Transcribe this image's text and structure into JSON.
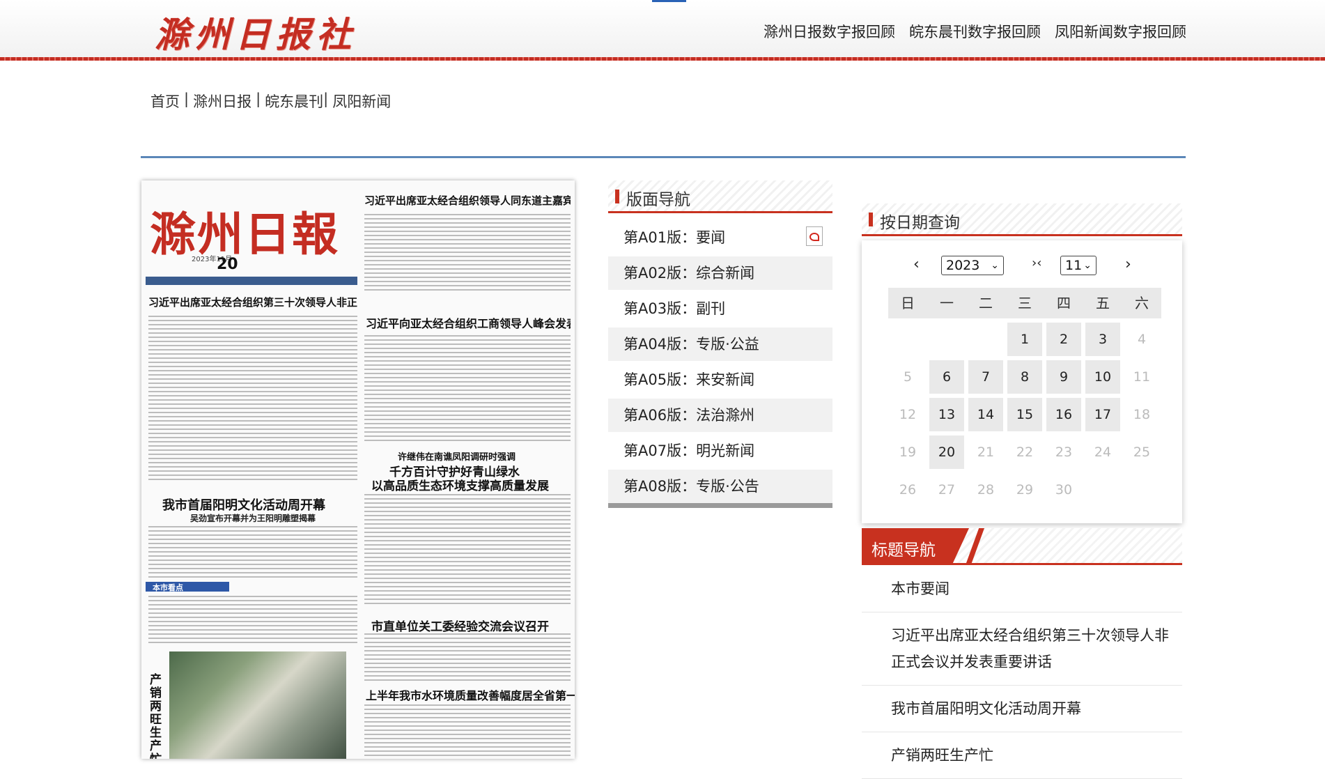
{
  "header": {
    "logo_text": "滁州日报社",
    "links": [
      "滁州日报数字报回顾",
      "皖东晨刊数字报回顾",
      "凤阳新闻数字报回顾"
    ]
  },
  "breadcrumb": {
    "items": [
      "首页",
      "滁州日报",
      "皖东晨刊",
      "凤阳新闻"
    ],
    "separators": [
      "|",
      "|",
      "|"
    ]
  },
  "paper": {
    "masthead": "滁州日報",
    "date_line": "2023年11月",
    "day": "20",
    "headlines": [
      "习近平出席亚太经合组织领导人同东道主嘉宾非正式对话会暨工作午宴",
      "习近平出席亚太经合组织第三十次领导人非正式会议并发表重要讲话",
      "习近平向亚太经合组织工商领导人峰会发表书面演讲",
      "许继伟在南谯凤阳调研时强调",
      "千方百计守护好青山绿水",
      "以高品质生态环境支撑高质量发展",
      "我市首届阳明文化活动周开幕",
      "吴劲宣布开幕并为王阳明雕塑揭幕",
      "市直单位关工委经验交流会议召开",
      "上半年我市水环境质量改善幅度居全省第一",
      "本市看点",
      "产销两旺生产忙"
    ]
  },
  "page_nav": {
    "title": "版面导航",
    "items": [
      "第A01版：要闻",
      "第A02版：综合新闻",
      "第A03版：副刊",
      "第A04版：专版·公益",
      "第A05版：来安新闻",
      "第A06版：法治滁州",
      "第A07版：明光新闻",
      "第A08版：专版·公告"
    ],
    "pdf_icon": "pdf-icon"
  },
  "date_query": {
    "title": "按日期查询",
    "prev": "‹",
    "next": "›",
    "middle": "›‹",
    "year": "2023",
    "month": "11",
    "weekdays": [
      "日",
      "一",
      "二",
      "三",
      "四",
      "五",
      "六"
    ],
    "weeks": [
      [
        {
          "d": "",
          "a": false
        },
        {
          "d": "",
          "a": false
        },
        {
          "d": "",
          "a": false
        },
        {
          "d": "1",
          "a": true
        },
        {
          "d": "2",
          "a": true
        },
        {
          "d": "3",
          "a": true
        },
        {
          "d": "4",
          "a": false
        }
      ],
      [
        {
          "d": "5",
          "a": false
        },
        {
          "d": "6",
          "a": true
        },
        {
          "d": "7",
          "a": true
        },
        {
          "d": "8",
          "a": true
        },
        {
          "d": "9",
          "a": true
        },
        {
          "d": "10",
          "a": true
        },
        {
          "d": "11",
          "a": false
        }
      ],
      [
        {
          "d": "12",
          "a": false
        },
        {
          "d": "13",
          "a": true
        },
        {
          "d": "14",
          "a": true
        },
        {
          "d": "15",
          "a": true
        },
        {
          "d": "16",
          "a": true
        },
        {
          "d": "17",
          "a": true
        },
        {
          "d": "18",
          "a": false
        }
      ],
      [
        {
          "d": "19",
          "a": false
        },
        {
          "d": "20",
          "a": true
        },
        {
          "d": "21",
          "a": false
        },
        {
          "d": "22",
          "a": false
        },
        {
          "d": "23",
          "a": false
        },
        {
          "d": "24",
          "a": false
        },
        {
          "d": "25",
          "a": false
        }
      ],
      [
        {
          "d": "26",
          "a": false
        },
        {
          "d": "27",
          "a": false
        },
        {
          "d": "28",
          "a": false
        },
        {
          "d": "29",
          "a": false
        },
        {
          "d": "30",
          "a": false
        },
        {
          "d": "",
          "a": false
        },
        {
          "d": "",
          "a": false
        }
      ]
    ]
  },
  "title_nav": {
    "title": "标题导航",
    "items": [
      "本市要闻",
      "习近平出席亚太经合组织第三十次领导人非正式会议并发表重要讲话",
      "我市首届阳明文化活动周开幕",
      "产销两旺生产忙"
    ]
  },
  "colors": {
    "brand_red": "#c42d22",
    "divider_blue": "#5b87b8"
  }
}
